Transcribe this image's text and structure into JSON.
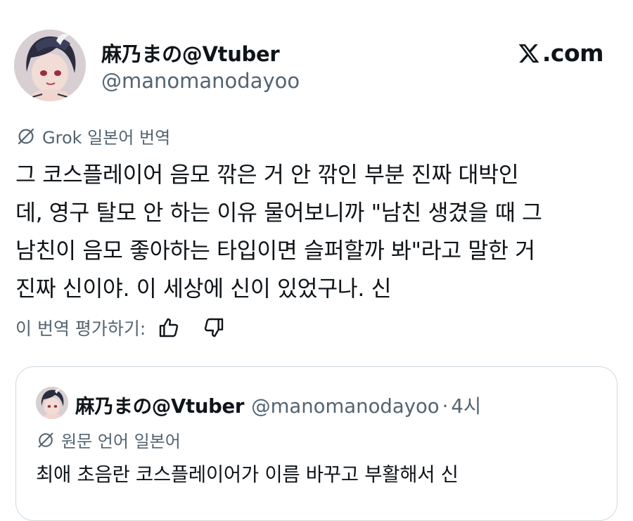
{
  "brand": {
    "domain_text": ".com",
    "logo_icon": "x-logo-icon"
  },
  "post": {
    "author": {
      "display_name": "麻乃まの@Vtuber",
      "handle": "@manomanodayoo",
      "avatar_icon": "avatar-image"
    },
    "translation": {
      "icon": "grok-icon",
      "label": "Grok 일본어 번역"
    },
    "text_lines": [
      "그 코스플레이어 음모 깎은 거 안 깎인 부분 진짜 대박인",
      "데, 영구 탈모 안 하는 이유 물어보니까 \"남친 생겼을 때 그",
      "남친이 음모 좋아하는 타입이면 슬퍼할까 봐\"라고 말한 거",
      "진짜 신이야. 이 세상에 신이 있었구나. 신"
    ],
    "rating": {
      "label": "이 번역 평가하기:",
      "thumbs_up_icon": "thumbs-up-icon",
      "thumbs_down_icon": "thumbs-down-icon"
    }
  },
  "quoted_post": {
    "author": {
      "display_name": "麻乃まの@Vtuber",
      "handle": "@manomanodayoo",
      "avatar_icon": "avatar-image"
    },
    "separator": "·",
    "time": "4시",
    "language": {
      "icon": "grok-icon",
      "label": "원문 언어 일본어"
    },
    "text": "최애 초음란 코스플레이어가 이름 바꾸고 부활해서 신"
  },
  "colors": {
    "primary_text": "#0f1419",
    "secondary_text": "#536471",
    "border": "#cfd9de",
    "background": "#ffffff"
  }
}
